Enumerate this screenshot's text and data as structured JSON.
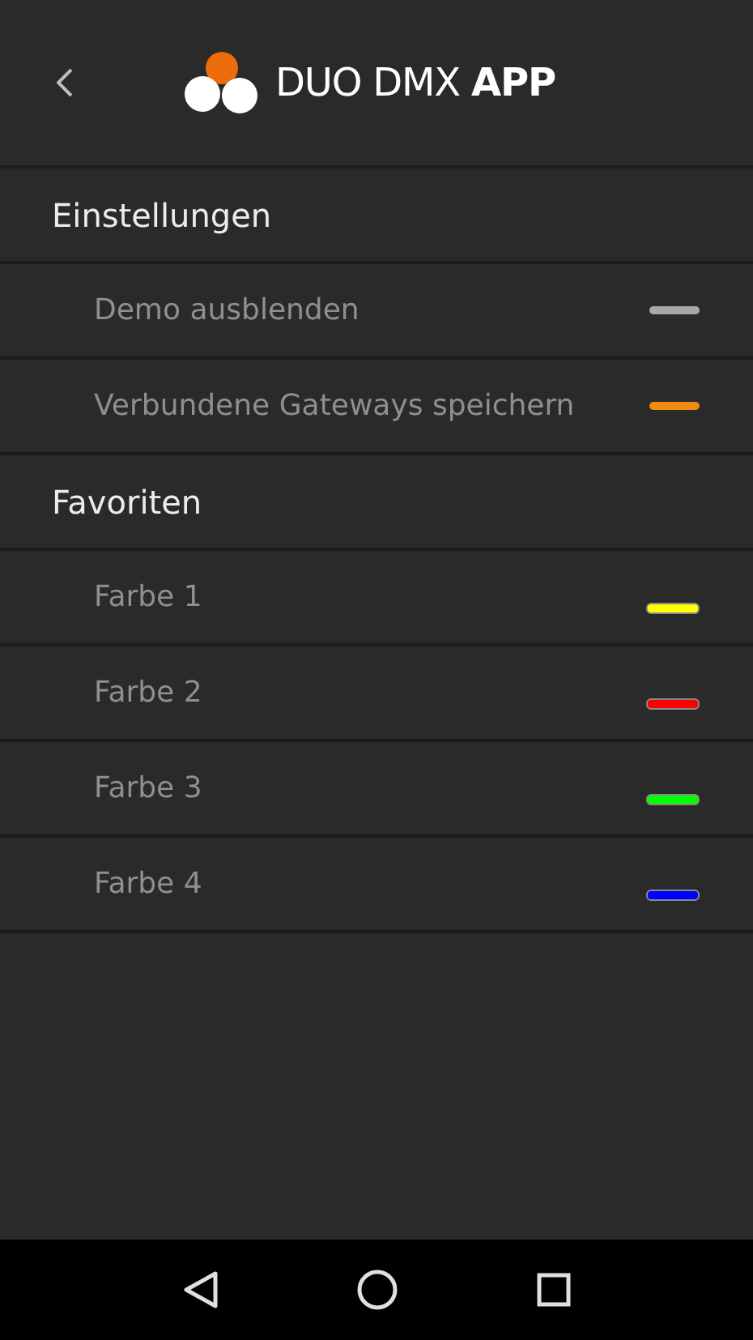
{
  "header": {
    "title": "DUO DMX **APP**"
  },
  "sections": [
    {
      "title": "Einstellungen",
      "items": [
        {
          "label": "Demo ausblenden",
          "kind": "toggle",
          "on": false
        },
        {
          "label": "Verbundene Gateways speichern",
          "kind": "toggle",
          "on": true
        }
      ]
    },
    {
      "title": "Favoriten",
      "items": [
        {
          "label": "Farbe 1",
          "kind": "color",
          "color": "#ffff00"
        },
        {
          "label": "Farbe 2",
          "kind": "color",
          "color": "#ff0000"
        },
        {
          "label": "Farbe 3",
          "kind": "color",
          "color": "#00ff00"
        },
        {
          "label": "Farbe 4",
          "kind": "color",
          "color": "#0000ff"
        }
      ]
    }
  ]
}
